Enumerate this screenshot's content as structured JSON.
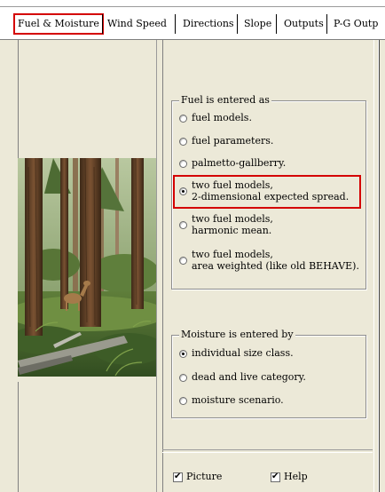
{
  "tabs": [
    {
      "label": "Fuel & Moisture",
      "selected": true
    },
    {
      "label": "Wind Speed"
    },
    {
      "label": "Directions"
    },
    {
      "label": "Slope"
    },
    {
      "label": "Outputs"
    },
    {
      "label": "P-G Outp"
    }
  ],
  "fuel_group": {
    "legend": "Fuel is entered as",
    "options": [
      {
        "line1": "fuel models.",
        "line2": "",
        "selected": false
      },
      {
        "line1": "fuel parameters.",
        "line2": "",
        "selected": false
      },
      {
        "line1": "palmetto-gallberry.",
        "line2": "",
        "selected": false
      },
      {
        "line1": "two fuel models,",
        "line2": "2-dimensional expected spread.",
        "selected": true
      },
      {
        "line1": "two fuel models,",
        "line2": "harmonic mean.",
        "selected": false
      },
      {
        "line1": "two fuel models,",
        "line2": "area weighted (like old BEHAVE).",
        "selected": false
      }
    ]
  },
  "moisture_group": {
    "legend": "Moisture is entered by",
    "options": [
      {
        "label": "individual size class.",
        "selected": true
      },
      {
        "label": "dead and live category.",
        "selected": false
      },
      {
        "label": "moisture scenario.",
        "selected": false
      }
    ]
  },
  "checkboxes": [
    {
      "label": "Picture",
      "checked": true
    },
    {
      "label": "Help",
      "checked": true
    }
  ],
  "colors": {
    "panel_bg": "#ece9d8",
    "highlight": "#d40000"
  },
  "icons": {
    "picture": "forest-deer-illustration"
  }
}
